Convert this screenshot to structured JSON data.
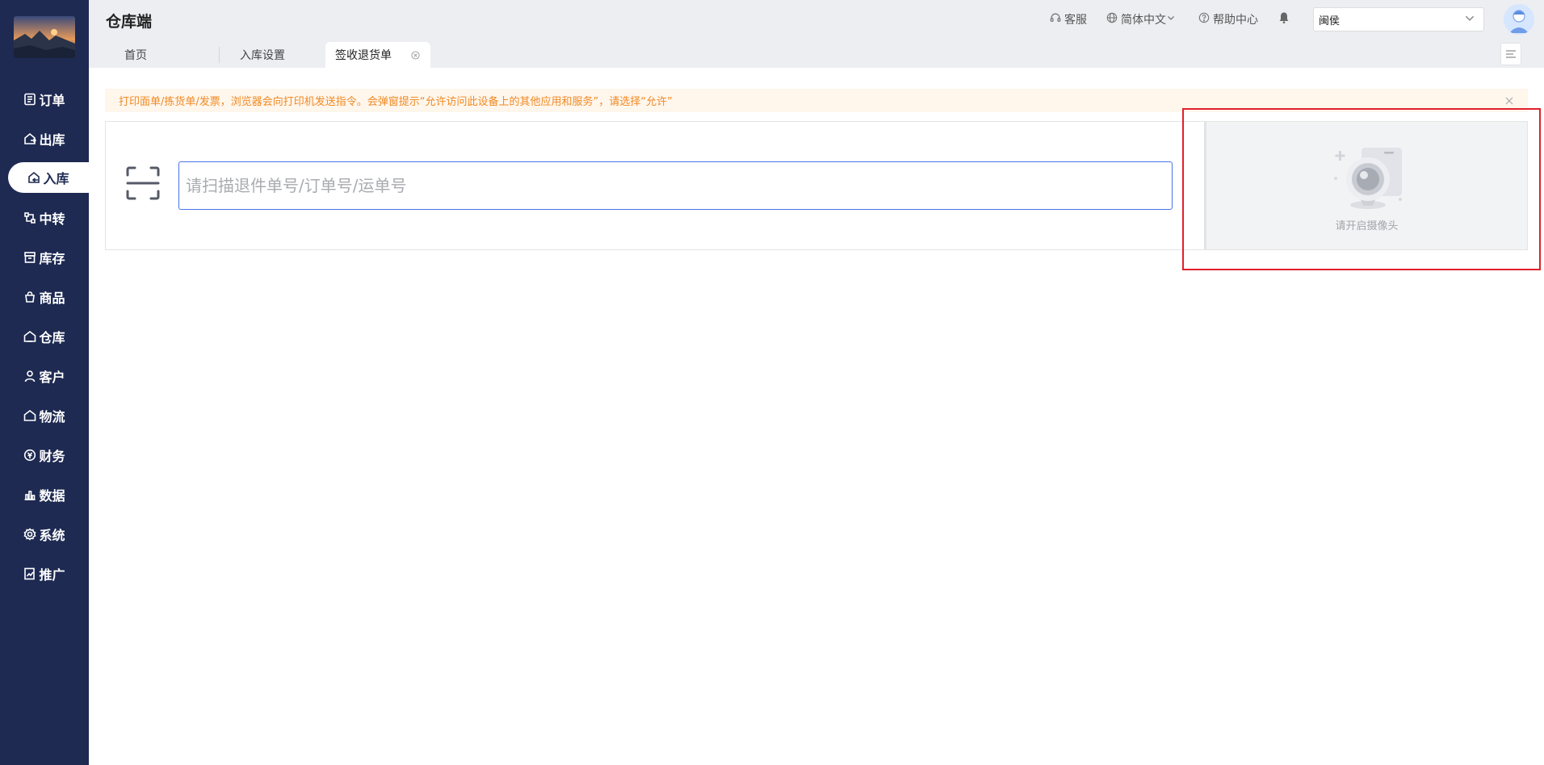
{
  "app": {
    "title": "仓库端"
  },
  "header": {
    "links": [
      {
        "label": "客服",
        "icon": "headset-icon"
      },
      {
        "label": "简体中文",
        "icon": "globe-icon"
      },
      {
        "label": "帮助中心",
        "icon": "help-icon"
      }
    ],
    "user_select_value": "闽侯"
  },
  "sidebar": {
    "items": [
      {
        "label": "订单",
        "icon": "order-icon"
      },
      {
        "label": "出库",
        "icon": "outbound-icon"
      },
      {
        "label": "入库",
        "icon": "inbound-icon",
        "active": true
      },
      {
        "label": "中转",
        "icon": "transfer-icon"
      },
      {
        "label": "库存",
        "icon": "inventory-icon"
      },
      {
        "label": "商品",
        "icon": "goods-icon"
      },
      {
        "label": "仓库",
        "icon": "warehouse-icon"
      },
      {
        "label": "客户",
        "icon": "customer-icon"
      },
      {
        "label": "物流",
        "icon": "logistics-icon"
      },
      {
        "label": "财务",
        "icon": "finance-icon"
      },
      {
        "label": "数据",
        "icon": "data-icon"
      },
      {
        "label": "系统",
        "icon": "system-icon"
      },
      {
        "label": "推广",
        "icon": "promotion-icon"
      }
    ]
  },
  "tabs": [
    {
      "label": "首页"
    },
    {
      "label": "入库设置"
    },
    {
      "label": "签收退货单",
      "active": true
    }
  ],
  "alert": {
    "text": "打印面单/拣货单/发票，浏览器会向打印机发送指令。会弹窗提示“允许访问此设备上的其他应用和服务”，请选择“允许”"
  },
  "scan": {
    "placeholder": "请扫描退件单号/订单号/运单号",
    "value": ""
  },
  "camera": {
    "text": "请开启摄像头"
  },
  "colors": {
    "sidebar_bg": "#1e2a52",
    "accent": "#4a74e8",
    "alert_text": "#f08a24",
    "alert_bg": "#fff6ec",
    "highlight": "#e0202b"
  }
}
